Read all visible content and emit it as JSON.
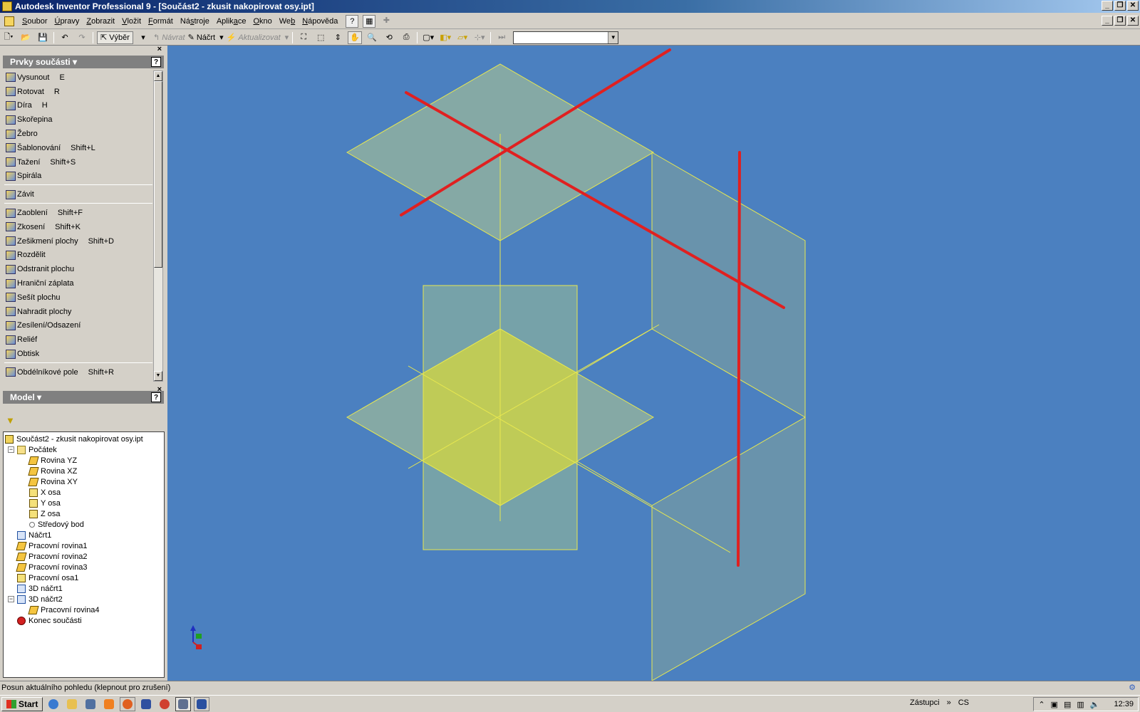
{
  "window": {
    "title": "Autodesk Inventor Professional 9 - [Součást2 - zkusit nakopirovat osy.ipt]"
  },
  "menu": {
    "items": [
      {
        "pre": "",
        "ul": "S",
        "post": "oubor"
      },
      {
        "pre": "",
        "ul": "Ú",
        "post": "pravy"
      },
      {
        "pre": "",
        "ul": "Z",
        "post": "obrazit"
      },
      {
        "pre": "",
        "ul": "V",
        "post": "ložit"
      },
      {
        "pre": "",
        "ul": "F",
        "post": "ormát"
      },
      {
        "pre": "Ná",
        "ul": "s",
        "post": "troje"
      },
      {
        "pre": "Aplik",
        "ul": "a",
        "post": "ce"
      },
      {
        "pre": "",
        "ul": "O",
        "post": "kno"
      },
      {
        "pre": "We",
        "ul": "b",
        "post": ""
      },
      {
        "pre": "",
        "ul": "N",
        "post": "ápověda"
      }
    ]
  },
  "toolbar": {
    "select_label": "Výběr",
    "return_label": "Návrat",
    "sketch_label": "Náčrt",
    "update_label": "Aktualizovat",
    "combo_value": ""
  },
  "features_panel": {
    "title": "Prvky součásti ▾",
    "help": "?",
    "groups": [
      [
        {
          "label": "Vysunout",
          "shortcut": "E"
        },
        {
          "label": "Rotovat",
          "shortcut": "R"
        },
        {
          "label": "Díra",
          "shortcut": "H"
        },
        {
          "label": "Skořepina",
          "shortcut": ""
        },
        {
          "label": "Žebro",
          "shortcut": ""
        },
        {
          "label": "Šablonování",
          "shortcut": "Shift+L"
        },
        {
          "label": "Tažení",
          "shortcut": "Shift+S"
        },
        {
          "label": "Spirála",
          "shortcut": ""
        }
      ],
      [
        {
          "label": "Závit",
          "shortcut": ""
        }
      ],
      [
        {
          "label": "Zaoblení",
          "shortcut": "Shift+F"
        },
        {
          "label": "Zkosení",
          "shortcut": "Shift+K"
        },
        {
          "label": "Zešikmení plochy",
          "shortcut": "Shift+D"
        },
        {
          "label": "Rozdělit",
          "shortcut": ""
        },
        {
          "label": "Odstranit plochu",
          "shortcut": ""
        },
        {
          "label": "Hraniční záplata",
          "shortcut": ""
        },
        {
          "label": "Sešít plochu",
          "shortcut": ""
        },
        {
          "label": "Nahradit plochy",
          "shortcut": ""
        },
        {
          "label": "Zesílení/Odsazení",
          "shortcut": ""
        },
        {
          "label": "Reliéf",
          "shortcut": ""
        },
        {
          "label": "Obtisk",
          "shortcut": ""
        }
      ],
      [
        {
          "label": "Obdélníkové pole",
          "shortcut": "Shift+R"
        }
      ]
    ]
  },
  "model_panel": {
    "title": "Model ▾",
    "help": "?",
    "tree": [
      {
        "label": "Součást2 - zkusit nakopirovat osy.ipt",
        "icon": "part",
        "level": 0
      },
      {
        "label": "Počátek",
        "icon": "folder",
        "level": 1
      },
      {
        "label": "Rovina YZ",
        "icon": "plane",
        "level": 2
      },
      {
        "label": "Rovina XZ",
        "icon": "plane",
        "level": 2
      },
      {
        "label": "Rovina XY",
        "icon": "plane",
        "level": 2
      },
      {
        "label": "X osa",
        "icon": "axis",
        "level": 2
      },
      {
        "label": "Y osa",
        "icon": "axis",
        "level": 2
      },
      {
        "label": "Z osa",
        "icon": "axis",
        "level": 2
      },
      {
        "label": "Středový bod",
        "icon": "point",
        "level": 2
      },
      {
        "label": "Náčrt1",
        "icon": "sketch",
        "level": 1
      },
      {
        "label": "Pracovní rovina1",
        "icon": "plane",
        "level": 1
      },
      {
        "label": "Pracovní rovina2",
        "icon": "plane",
        "level": 1
      },
      {
        "label": "Pracovní rovina3",
        "icon": "plane",
        "level": 1
      },
      {
        "label": "Pracovní osa1",
        "icon": "axis",
        "level": 1
      },
      {
        "label": "3D náčrt1",
        "icon": "sketch",
        "level": 1
      },
      {
        "label": "3D náčrt2",
        "icon": "sketch",
        "level": 1
      },
      {
        "label": "Pracovní rovina4",
        "icon": "plane",
        "level": 2
      },
      {
        "label": "Konec součásti",
        "icon": "end",
        "level": 1
      }
    ]
  },
  "viewport": {
    "background": "#4b80c0",
    "plane_fill": "#8fb0a0",
    "plane_edge": "#e8e850",
    "highlight_fill": "#c8d04a",
    "annotation_color": "#e02020"
  },
  "status": {
    "text": "Posun aktuálního pohledu (klepnout pro zrušení)"
  },
  "taskbar": {
    "start_label": "Start",
    "quicklaunch_label": "Zástupci",
    "language": "CS",
    "clock": "12:39"
  }
}
